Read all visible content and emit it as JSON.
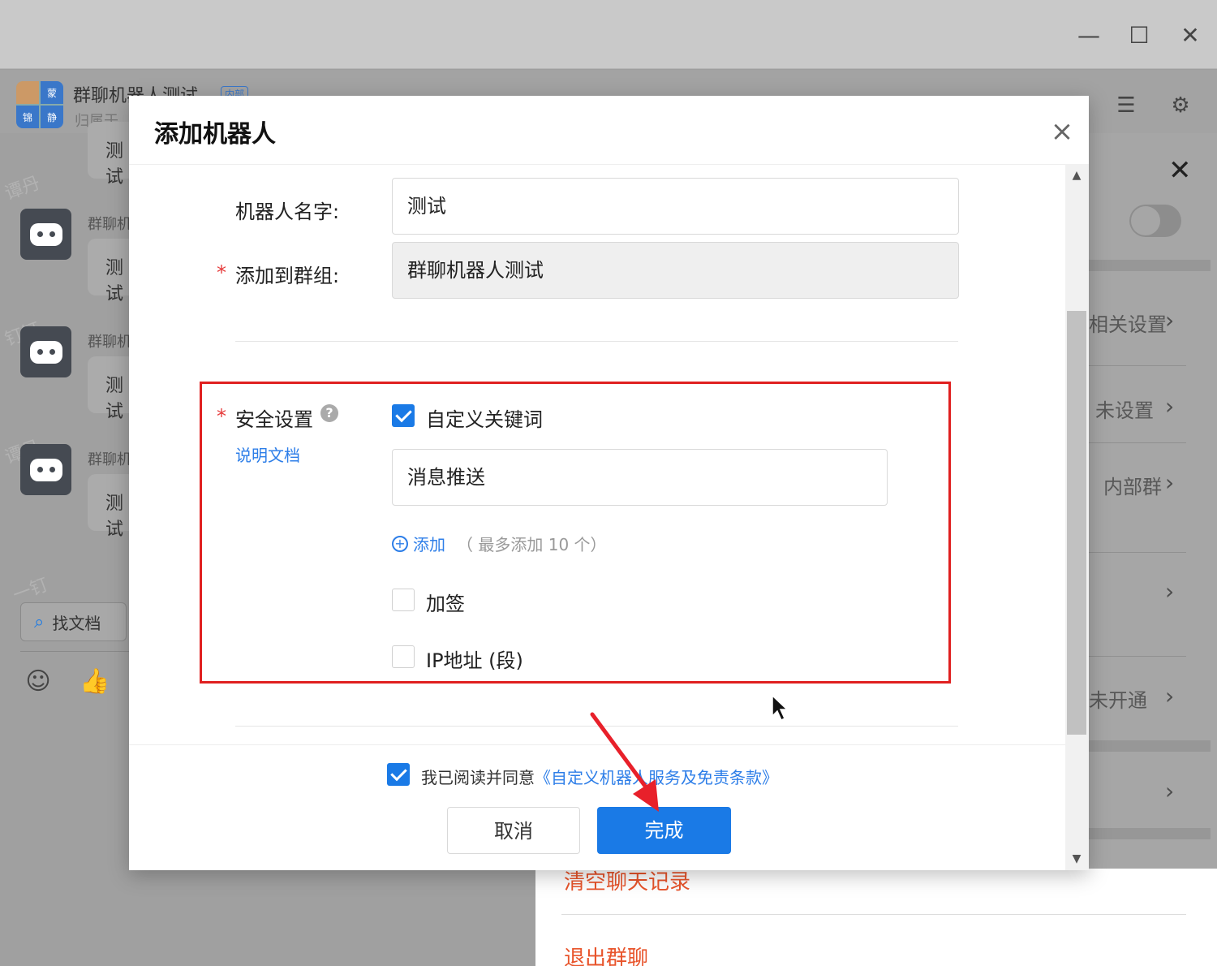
{
  "window": {
    "minimize_icon": "minimize-icon",
    "maximize_icon": "maximize-icon",
    "close_icon": "close-icon"
  },
  "chat_header": {
    "avatar_chars": [
      "蒙",
      "锦",
      "静"
    ],
    "group_name": "群聊机器人测试",
    "tag": "内部",
    "subtitle": "归属于"
  },
  "chat": {
    "bots": [
      {
        "name": "群聊机",
        "bubble": "测试"
      },
      {
        "name": "群聊机",
        "bubble": "测试"
      },
      {
        "name": "群聊机",
        "bubble": "测试"
      },
      {
        "name": "",
        "bubble": "测试"
      }
    ],
    "watermarks": [
      "谭丹",
      "钉钉",
      "谭丹",
      "一钉"
    ],
    "find_doc_label": "找文档"
  },
  "side_panel": {
    "rows": [
      {
        "text": "相关设置"
      },
      {
        "text": "未设置"
      },
      {
        "text": "内部群"
      },
      {
        "text": ""
      },
      {
        "text": "未开通"
      },
      {
        "text": ""
      }
    ],
    "clear_history": "清空聊天记录",
    "leave_group": "退出群聊"
  },
  "modal": {
    "title": "添加机器人",
    "form": {
      "robot_name_label": "机器人名字:",
      "robot_name_value": "测试",
      "add_to_group_label": "添加到群组:",
      "add_to_group_value": "群聊机器人测试",
      "required_mark": "*",
      "security_label": "安全设置",
      "help_char": "?",
      "doc_link": "说明文档",
      "custom_keyword_label": "自定义关键词",
      "custom_keyword_checked": true,
      "keyword_value": "消息推送",
      "add_label": "添加",
      "add_hint": "（ 最多添加 10 个）",
      "sign_label": "加签",
      "sign_checked": false,
      "ip_label": "IP地址 (段)",
      "ip_checked": false
    },
    "footer": {
      "agree_checked": true,
      "agree_prefix": "我已阅读并同意",
      "agree_link": "《自定义机器人服务及免责条款》",
      "cancel_label": "取消",
      "done_label": "完成"
    }
  },
  "colors": {
    "primary": "#1a7ae6",
    "link": "#2d7ee8",
    "danger": "#e8542b",
    "highlight_border": "#e02020",
    "annotation_arrow": "#e8202a"
  }
}
